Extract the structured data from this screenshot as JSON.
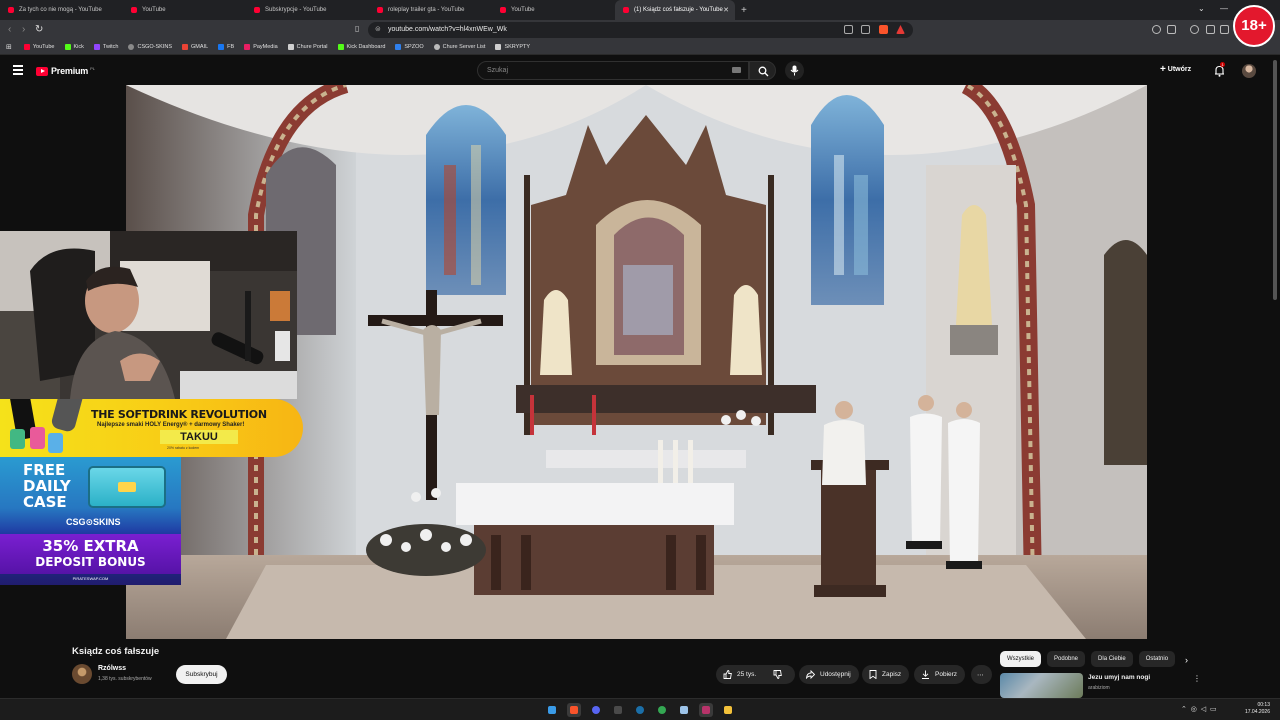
{
  "browser": {
    "tabs": [
      {
        "title": "Za tych co nie mogą - YouTube",
        "active": false
      },
      {
        "title": "YouTube",
        "active": false
      },
      {
        "title": "Subskrypcje - YouTube",
        "active": false
      },
      {
        "title": "roleplay trailer gta - YouTube",
        "active": false
      },
      {
        "title": "YouTube",
        "active": false
      },
      {
        "title": "(1) Ksiądz coś fałszuje - YouTube",
        "active": true
      }
    ],
    "url": "youtube.com/watch?v=hl4xnWEw_Wk",
    "bookmarks": [
      "YouTube",
      "Kick",
      "Twitch",
      "CSGO-SKINS",
      "GMAIL",
      "FB",
      "PayMedia",
      "Chure Portal",
      "Kick Dashboard",
      "SPZOO",
      "Chure Server List",
      "SKRYPTY"
    ],
    "bookmark_colors": [
      "#ff0033",
      "#53fc18",
      "#9146ff",
      "#8a8a8a",
      "#ea4335",
      "#1877f2",
      "#e91e63",
      "#cfcfcf",
      "#53fc18",
      "#2f80ed",
      "#bbbbbb",
      "#cfcfcf"
    ]
  },
  "age_badge": "18+",
  "youtube": {
    "logo_text": "Premium",
    "country_code": "PL",
    "search_placeholder": "Szukaj",
    "create_label": "Utwórz",
    "notification_count": "1"
  },
  "ad": {
    "headline": "THE SOFTDRINK REVOLUTION",
    "subline": "Najlepsze smaki HOLY Energy® + darmowy Shaker!",
    "code": "TAKUU",
    "fine_print": "20% rabatu z kodem",
    "case_title_1": "FREE",
    "case_title_2": "DAILY",
    "case_title_3": "CASE",
    "case_brand": "CSG⊙SKINS",
    "bonus_1": "35% EXTRA",
    "bonus_2": "DEPOSIT BONUS",
    "site": "PIRATESWAP.COM"
  },
  "video": {
    "title": "Ksiądz coś fałszuje",
    "channel": "Rzólwss",
    "subscribers": "1,38 tys. subskrybentów",
    "subscribe_label": "Subskrybuj",
    "likes": "25 tys.",
    "share_label": "Udostępnij",
    "save_label": "Zapisz",
    "download_label": "Pobierz"
  },
  "chips": [
    "Wszystkie",
    "Podobne",
    "Dla Ciebie",
    "Ostatnio"
  ],
  "suggestion": {
    "title": "Jezu umyj nam nogi",
    "channel": "arabiziom"
  },
  "clock": {
    "time": "00:13",
    "date": "17.04.2026"
  }
}
